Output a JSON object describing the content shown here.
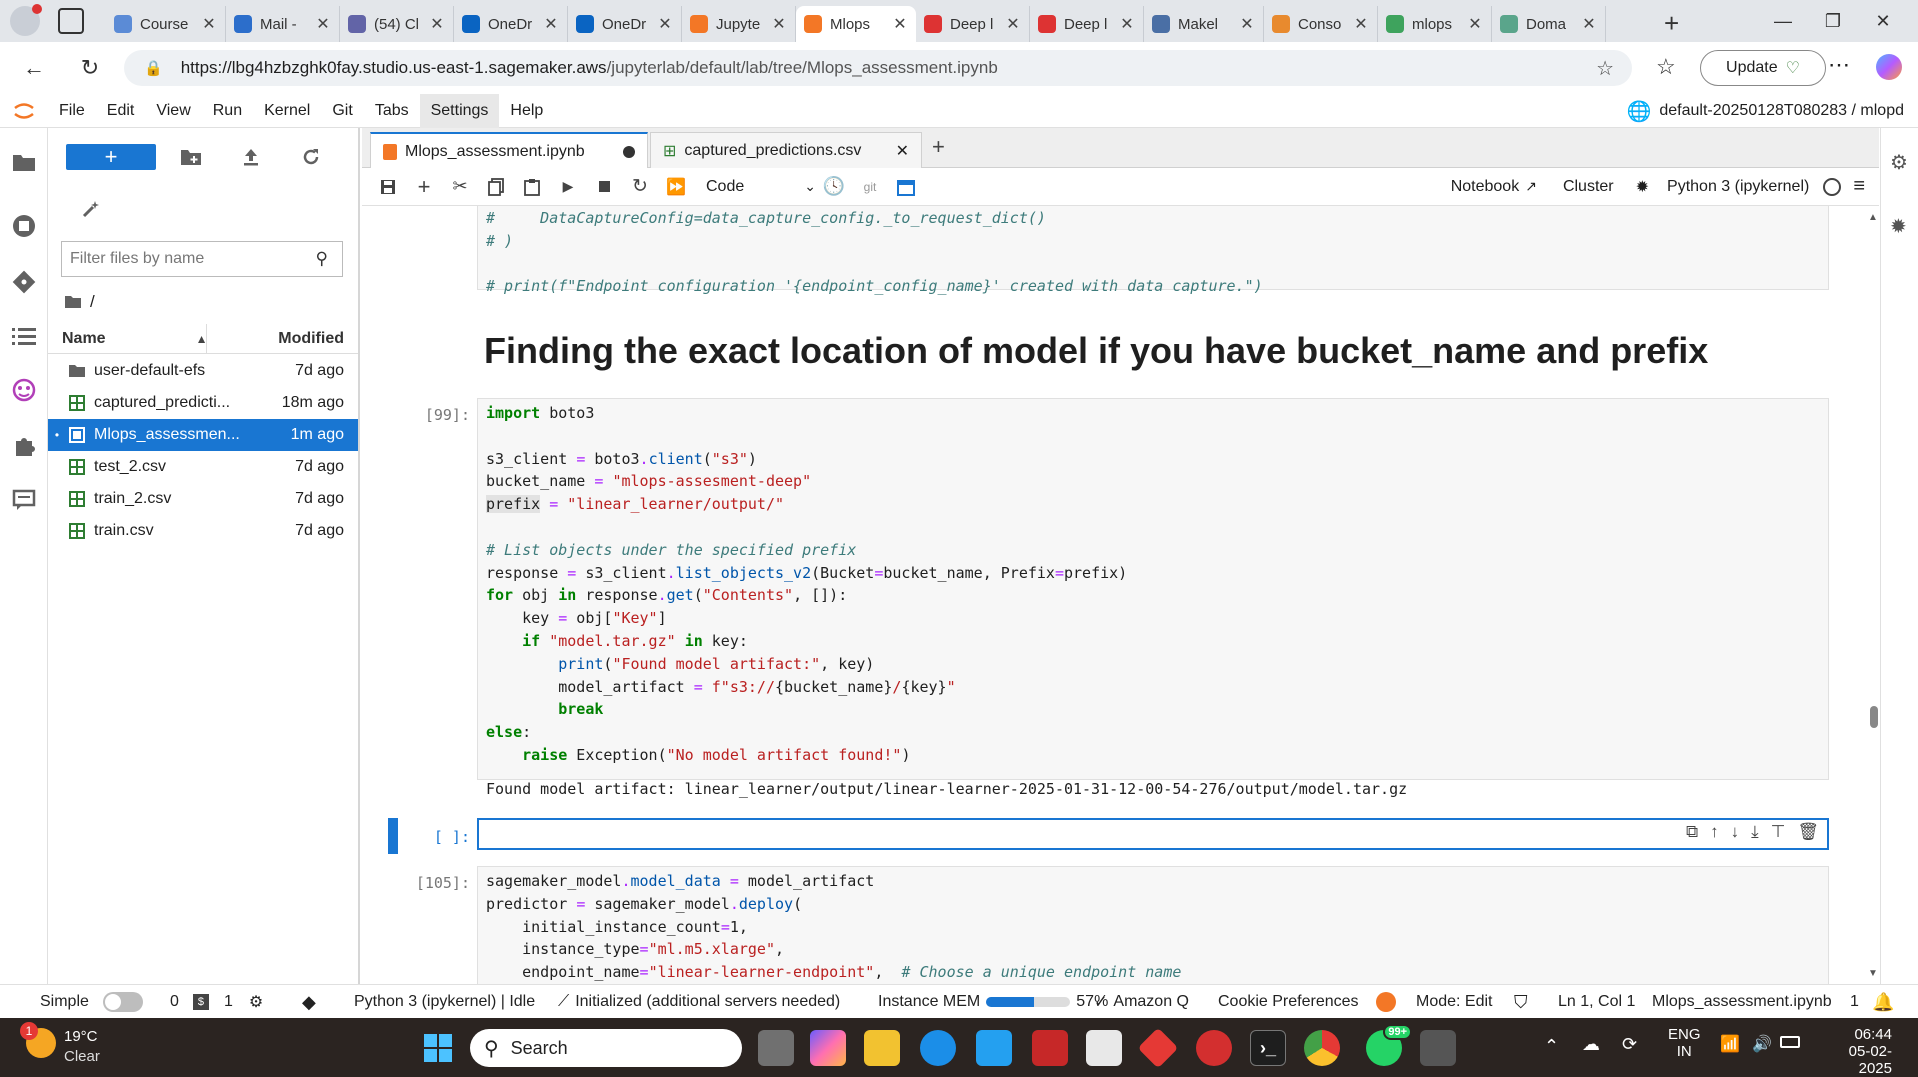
{
  "browser": {
    "tabs": [
      {
        "label": "Course",
        "color": "#5b8bd6"
      },
      {
        "label": "Mail -",
        "color": "#2c6ecb"
      },
      {
        "label": "(54) Cl",
        "color": "#6264a7"
      },
      {
        "label": "OneDr",
        "color": "#0a64c2"
      },
      {
        "label": "OneDr",
        "color": "#0a64c2"
      },
      {
        "label": "Jupyte",
        "color": "#f37726"
      },
      {
        "label": "Mlops",
        "color": "#f37726",
        "active": true
      },
      {
        "label": "Deep l",
        "color": "#d33"
      },
      {
        "label": "Deep l",
        "color": "#d33"
      },
      {
        "label": "Makel",
        "color": "#4a6fa5"
      },
      {
        "label": "Conso",
        "color": "#e88a2e"
      },
      {
        "label": "mlops",
        "color": "#3ea35d"
      },
      {
        "label": "Doma",
        "color": "#5aa58b"
      }
    ],
    "new_tab": "+",
    "url_host": "https://lbg4hzbzghk0fay.studio.us-east-1.sagemaker.aws",
    "url_path": "/jupyterlab/default/lab/tree/Mlops_assessment.ipynb",
    "update_label": "Update"
  },
  "menu": {
    "items": [
      "File",
      "Edit",
      "View",
      "Run",
      "Kernel",
      "Git",
      "Tabs",
      "Settings",
      "Help"
    ],
    "kernel_path": "default-20250128T080283 / mlopd"
  },
  "filebrowser": {
    "new_label": "+",
    "filter_placeholder": "Filter files by name",
    "crumb": "/",
    "col_name": "Name",
    "col_modified": "Modified",
    "files": [
      {
        "name": "user-default-efs",
        "modified": "7d ago",
        "type": "folder"
      },
      {
        "name": "captured_predicti...",
        "modified": "18m ago",
        "type": "csv"
      },
      {
        "name": "Mlops_assessmen...",
        "modified": "1m ago",
        "type": "notebook",
        "selected": true
      },
      {
        "name": "test_2.csv",
        "modified": "7d ago",
        "type": "csv"
      },
      {
        "name": "train_2.csv",
        "modified": "7d ago",
        "type": "csv"
      },
      {
        "name": "train.csv",
        "modified": "7d ago",
        "type": "csv"
      }
    ]
  },
  "notebook": {
    "tabs": [
      {
        "label": "Mlops_assessment.ipynb",
        "active": true,
        "dirty": true
      },
      {
        "label": "captured_predictions.csv",
        "active": false
      }
    ],
    "cell_type": "Code",
    "git_label": "git",
    "notebook_link": "Notebook",
    "cluster": "Cluster",
    "kernel": "Python 3 (ipykernel)",
    "heading": "Finding the exact location of model if you have bucket_name and prefix",
    "prompt_99": "[99]:",
    "prompt_empty": "[ ]:",
    "prompt_105": "[105]:",
    "output_99": "Found model artifact: linear_learner/output/linear-learner-2025-01-31-12-00-54-276/output/model.tar.gz"
  },
  "statusbar": {
    "mode_simple": "Simple",
    "terminals": "0",
    "kernels": "1",
    "kernel_status": "Python 3 (ipykernel) | Idle",
    "lsp": "Initialized (additional servers needed)",
    "mem_label": "Instance MEM",
    "mem_value": "57%",
    "mem_fraction": 0.57,
    "amazon_q": "Amazon Q",
    "cookie": "Cookie Preferences",
    "mode": "Mode: Edit",
    "position": "Ln 1, Col 1",
    "filename": "Mlops_assessment.ipynb",
    "count": "1"
  },
  "taskbar": {
    "weather_temp": "19°C",
    "weather_desc": "Clear",
    "weather_badge": "1",
    "search": "Search",
    "lang_top": "ENG",
    "lang_bottom": "IN",
    "time": "06:44",
    "date": "05-02-2025",
    "whatsapp_badge": "99+"
  }
}
